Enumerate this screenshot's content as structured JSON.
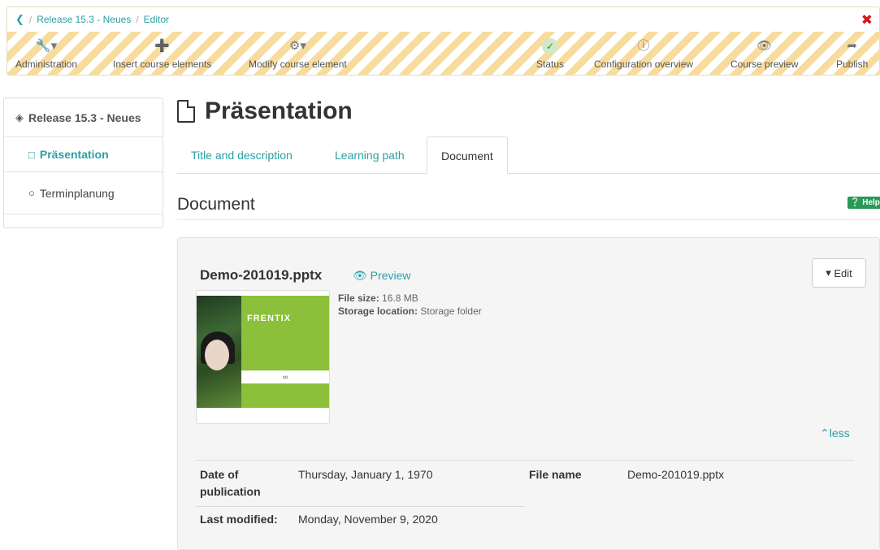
{
  "breadcrumb": {
    "back_icon": "chevron-left-icon",
    "course": "Release 15.3 - Neues",
    "editor": "Editor"
  },
  "toolbar": {
    "administration": "Administration",
    "insert": "Insert course elements",
    "modify": "Modify course element",
    "status": "Status",
    "config": "Configuration overview",
    "preview": "Course preview",
    "publish": "Publish"
  },
  "sidebar": {
    "root": "Release 15.3 - Neues",
    "items": [
      {
        "label": "Präsentation",
        "icon": "file-icon"
      },
      {
        "label": "Terminplanung",
        "icon": "circle-icon"
      }
    ]
  },
  "page": {
    "title": "Präsentation"
  },
  "tabs": [
    "Title and description",
    "Learning path",
    "Document"
  ],
  "section": {
    "title": "Document",
    "help": "Help"
  },
  "document": {
    "filename": "Demo-201019.pptx",
    "preview_label": "Preview",
    "edit_label": "Edit",
    "file_size_label": "File size:",
    "file_size": "16.8 MB",
    "storage_label": "Storage location:",
    "storage": "Storage folder",
    "less_label": "less",
    "thumb_logo": "FRENTIX",
    "pub_label_1": "Date of",
    "pub_label_2": "publication",
    "pub_value": "Thursday, January 1, 1970",
    "mod_label": "Last modified:",
    "mod_value": "Monday, November 9, 2020",
    "name_label": "File name",
    "name_value": "Demo-201019.pptx"
  },
  "colors": {
    "accent": "#2a9fa6",
    "close": "#d61a1a",
    "help": "#2a9a5a",
    "thumb_green": "#8cbf3a"
  }
}
